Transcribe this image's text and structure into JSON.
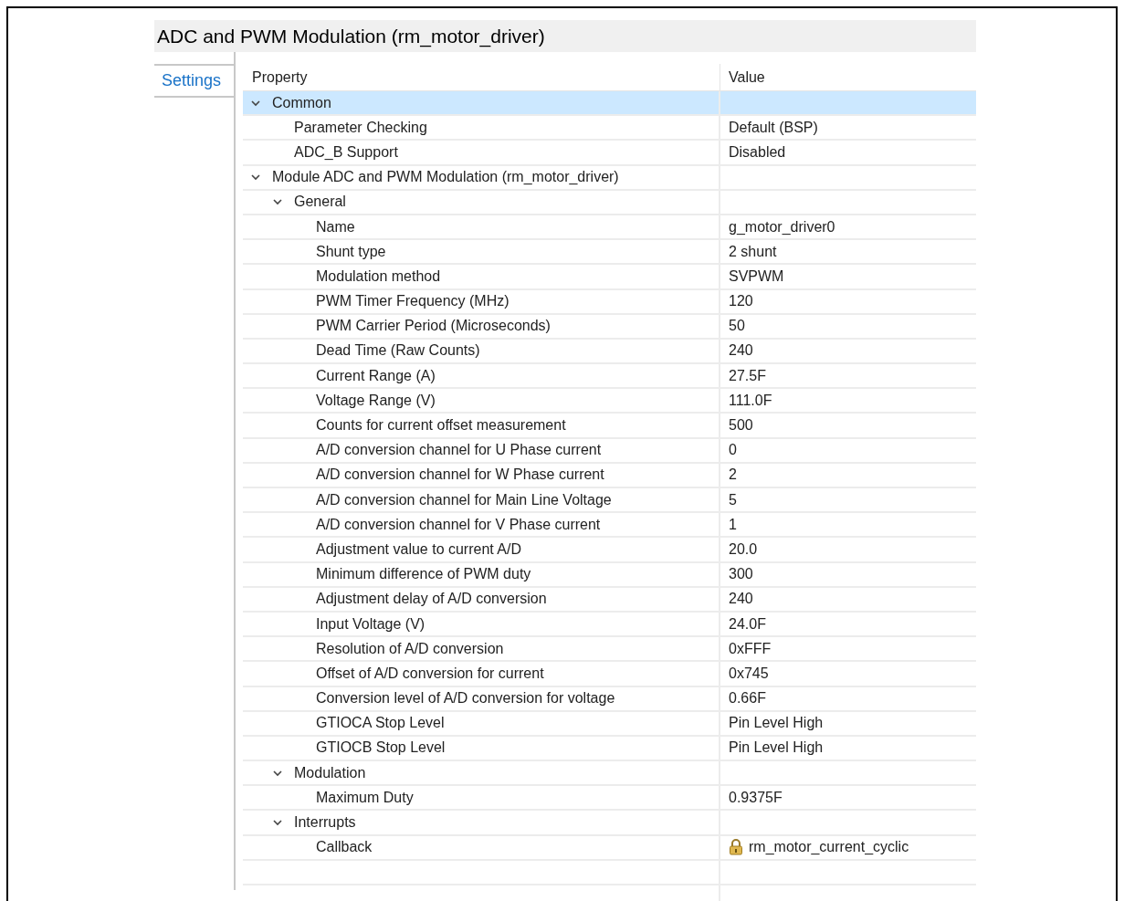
{
  "panel": {
    "title": "ADC and PWM Modulation (rm_motor_driver)"
  },
  "tabs": [
    {
      "label": "Settings",
      "selected": true
    }
  ],
  "table": {
    "columns": [
      "Property",
      "Value"
    ],
    "rows": [
      {
        "property": "Common",
        "expanded": true,
        "selected": true,
        "children": [
          {
            "property": "Parameter Checking",
            "value": "Default (BSP)",
            "selected": false
          },
          {
            "property": "ADC_B Support",
            "value": "Disabled",
            "selected": false
          }
        ]
      },
      {
        "property": "Module ADC and PWM Modulation (rm_motor_driver)",
        "expanded": true,
        "selected": false,
        "children": [
          {
            "property": "General",
            "expanded": true,
            "selected": false,
            "children": [
              {
                "property": "Name",
                "value": "g_motor_driver0",
                "selected": false
              },
              {
                "property": "Shunt type",
                "value": "2 shunt",
                "selected": false
              },
              {
                "property": "Modulation method",
                "value": "SVPWM",
                "selected": false
              },
              {
                "property": "PWM Timer Frequency (MHz)",
                "value": "120",
                "selected": false
              },
              {
                "property": "PWM Carrier Period (Microseconds)",
                "value": "50",
                "selected": false
              },
              {
                "property": "Dead Time (Raw Counts)",
                "value": "240",
                "selected": false
              },
              {
                "property": "Current Range (A)",
                "value": "27.5F",
                "selected": false
              },
              {
                "property": "Voltage Range (V)",
                "value": "111.0F",
                "selected": false
              },
              {
                "property": "Counts for current offset measurement",
                "value": "500",
                "selected": false
              },
              {
                "property": "A/D conversion channel for U Phase current",
                "value": "0",
                "selected": false
              },
              {
                "property": "A/D conversion channel for W Phase current",
                "value": "2",
                "selected": false
              },
              {
                "property": "A/D conversion channel for Main Line Voltage",
                "value": "5",
                "selected": false
              },
              {
                "property": "A/D conversion channel for V Phase current",
                "value": "1",
                "selected": false
              },
              {
                "property": "Adjustment value to current A/D",
                "value": "20.0",
                "selected": false
              },
              {
                "property": "Minimum difference of PWM duty",
                "value": "300",
                "selected": false
              },
              {
                "property": "Adjustment delay of A/D conversion",
                "value": "240",
                "selected": false
              },
              {
                "property": "Input Voltage (V)",
                "value": "24.0F",
                "selected": false
              },
              {
                "property": "Resolution of A/D conversion",
                "value": "0xFFF",
                "selected": false
              },
              {
                "property": "Offset of A/D conversion for current",
                "value": "0x745",
                "selected": false
              },
              {
                "property": "Conversion level of A/D conversion for voltage",
                "value": "0.66F",
                "selected": false
              },
              {
                "property": "GTIOCA Stop Level",
                "value": "Pin Level High",
                "selected": false
              },
              {
                "property": "GTIOCB Stop Level",
                "value": "Pin Level High",
                "selected": false
              }
            ]
          },
          {
            "property": "Modulation",
            "expanded": true,
            "selected": false,
            "children": [
              {
                "property": "Maximum Duty",
                "value": "0.9375F",
                "selected": false
              }
            ]
          },
          {
            "property": "Interrupts",
            "expanded": true,
            "selected": false,
            "children": [
              {
                "property": "Callback",
                "value": "rm_motor_current_cyclic",
                "locked": true,
                "selected": false
              }
            ]
          }
        ]
      }
    ]
  }
}
